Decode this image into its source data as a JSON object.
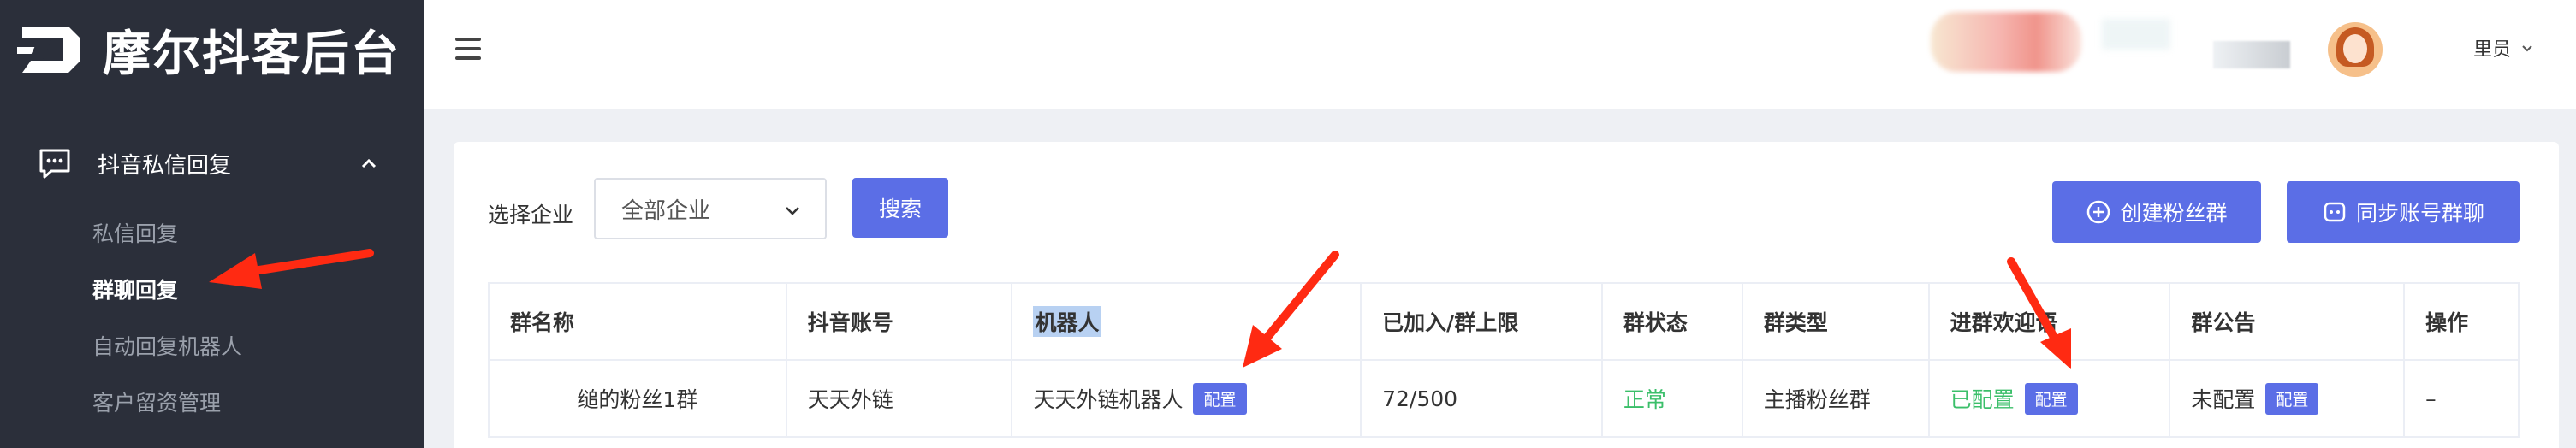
{
  "app": {
    "title": "摩尔抖客后台"
  },
  "sidebar": {
    "group": {
      "label": "抖音私信回复",
      "icon": "chat-icon",
      "expanded": true
    },
    "items": [
      {
        "label": "私信回复",
        "active": false
      },
      {
        "label": "群聊回复",
        "active": true
      },
      {
        "label": "自动回复机器人",
        "active": false
      },
      {
        "label": "客户留资管理",
        "active": false
      }
    ]
  },
  "header": {
    "menu_icon": "hamburger-icon",
    "user": {
      "name": "里员",
      "avatar_icon": "avatar"
    }
  },
  "filter": {
    "label": "选择企业",
    "select_value": "全部企业",
    "search_button": "搜索"
  },
  "actions": {
    "create_fan_group": "创建粉丝群",
    "sync_groups": "同步账号群聊"
  },
  "table": {
    "headers": [
      "群名称",
      "抖音账号",
      "机器人",
      "已加入/群上限",
      "群状态",
      "群类型",
      "进群欢迎语",
      "群公告",
      "操作"
    ],
    "rows": [
      {
        "group_name": "缒的粉丝1群",
        "account": "天天外链",
        "robot": "天天外链机器人",
        "robot_tag": "配置",
        "capacity": "72/500",
        "status": "正常",
        "type": "主播粉丝群",
        "welcome": "已配置",
        "welcome_tag": "配置",
        "notice": "未配置",
        "notice_tag": "配置",
        "operation": "–"
      }
    ]
  },
  "colors": {
    "sidebar_bg": "#2b2f3a",
    "primary": "#5b6ee6",
    "success": "#3bbf6a",
    "annotation": "#ff2a12"
  }
}
